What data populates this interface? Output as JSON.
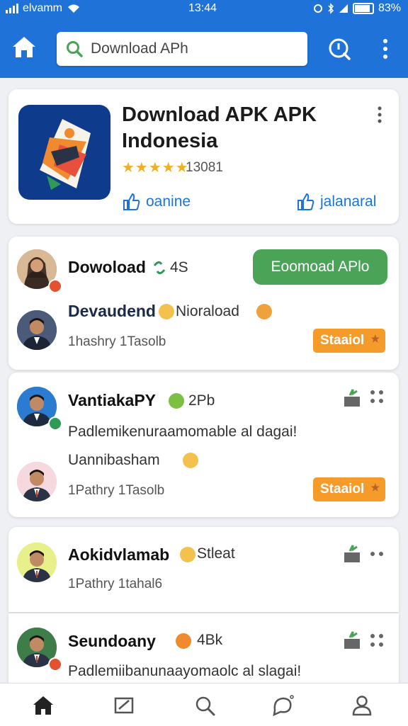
{
  "status_bar": {
    "carrier": "elvamm",
    "time": "13:44",
    "battery": "83%"
  },
  "header": {
    "search_placeholder": "Download APh",
    "icons": [
      "home-icon",
      "search-icon",
      "info-icon",
      "more-vertical-icon"
    ]
  },
  "app_card": {
    "title": "Download APK APK Indonesia",
    "stars": "★★★★★",
    "rating_count": "13081",
    "action_left": "oanine",
    "action_right": "jalanaral"
  },
  "feed": [
    {
      "name": "Dowoload",
      "meta": "4S",
      "button": "Eoomoad APlo"
    },
    {
      "name": "Devaudend",
      "meta": "Nioraload",
      "sub": "1hashry 1Tasolb",
      "button": "Staaiol"
    },
    {
      "name": "VantiakaPY",
      "meta": "2Pb",
      "text": "Padlemikenuraamomable al dagai!",
      "text2": "Uannibasham"
    },
    {
      "sub": "1Pathry 1Tasolb",
      "button": "Staaiol"
    },
    {
      "name": "Aokidvlamab",
      "meta": "Stleat",
      "sub": "1Pathry 1tahal6"
    },
    {
      "name": "Seundoany",
      "meta": "4Bk",
      "text": "Padlemiibanunaayomaolc al slagai!"
    }
  ],
  "bottom_nav": [
    "home-icon",
    "edit-icon",
    "search-icon",
    "chat-icon",
    "profile-icon"
  ],
  "colors": {
    "primary": "#1f73d8",
    "green": "#4aa357",
    "orange": "#f59b2a",
    "star": "#f0b020"
  }
}
